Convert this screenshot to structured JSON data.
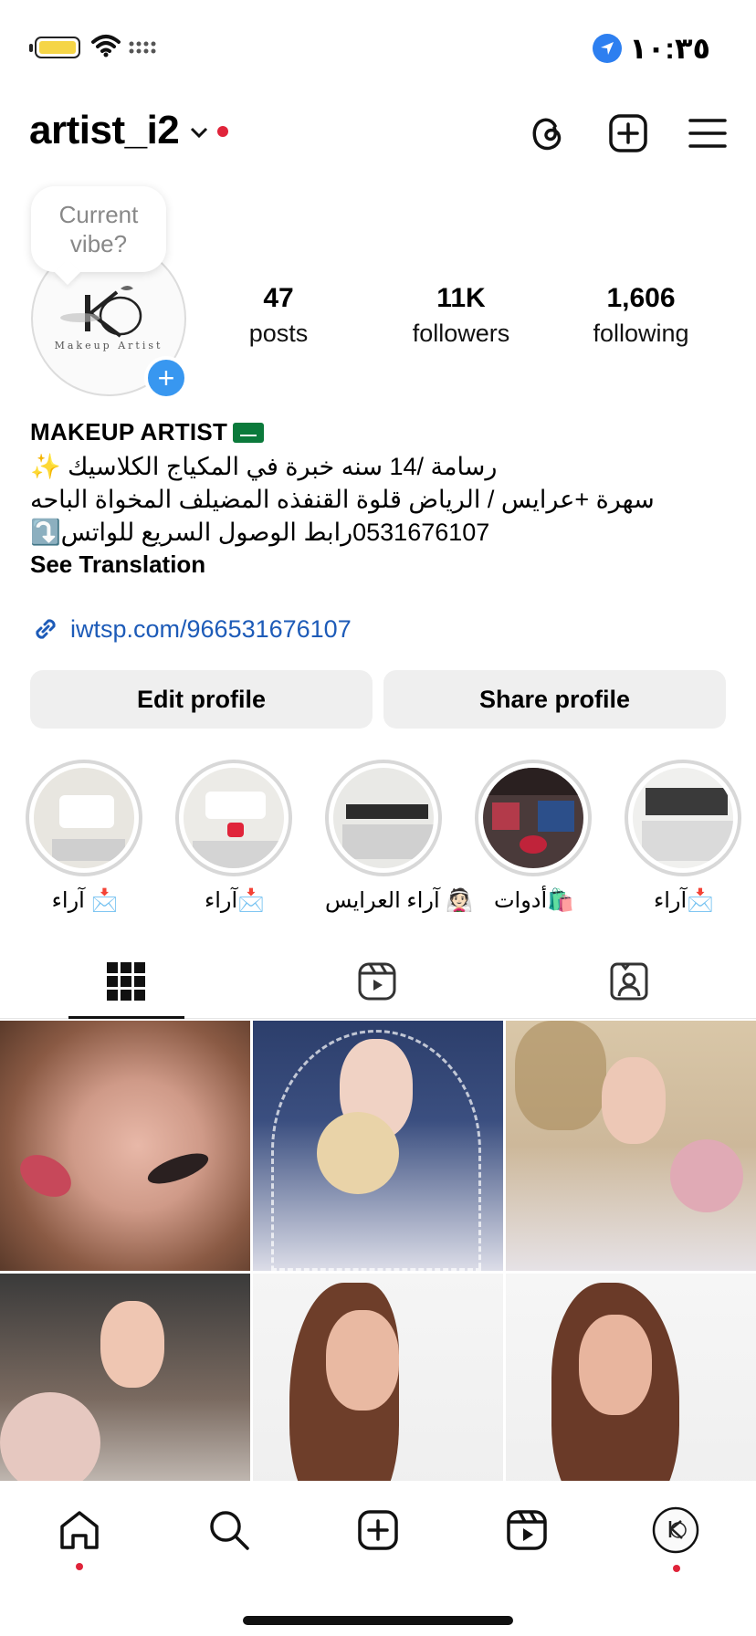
{
  "status_bar": {
    "time": "١٠:٣٥"
  },
  "header": {
    "username": "artist_i2"
  },
  "profile": {
    "bubble_text": "Current vibe?",
    "avatar_logo_text": "Makeup Artist",
    "stats": [
      {
        "value": "47",
        "label": "posts"
      },
      {
        "value": "11K",
        "label": "followers"
      },
      {
        "value": "1,606",
        "label": "following"
      }
    ]
  },
  "bio": {
    "name": "MAKEUP ARTIST",
    "line1": "رسامة /14 سنه خبرة في المكياج الكلاسيك ✨",
    "line2": "سهرة +عرايس / الرياض قلوة القنفذه المضيلف المخواة الباحه",
    "line3": "0531676107رابط الوصول السريع للواتس⤵️",
    "see_translation": "See Translation",
    "link": "iwtsp.com/966531676107"
  },
  "buttons": {
    "edit_profile": "Edit profile",
    "share_profile": "Share profile"
  },
  "highlights": [
    {
      "label": "آراء 📩"
    },
    {
      "label": "آراء📩"
    },
    {
      "label": "آراء العرايس 👰🏻"
    },
    {
      "label": "أدوات🛍️"
    },
    {
      "label": "آراء📩"
    }
  ],
  "tabs": [
    "grid",
    "reels",
    "tagged"
  ],
  "grid_posts": 6,
  "colors": {
    "link": "#1d5bb8",
    "accent_blue": "#3897f0",
    "notification_red": "#e0243a",
    "button_bg": "#efefef"
  }
}
